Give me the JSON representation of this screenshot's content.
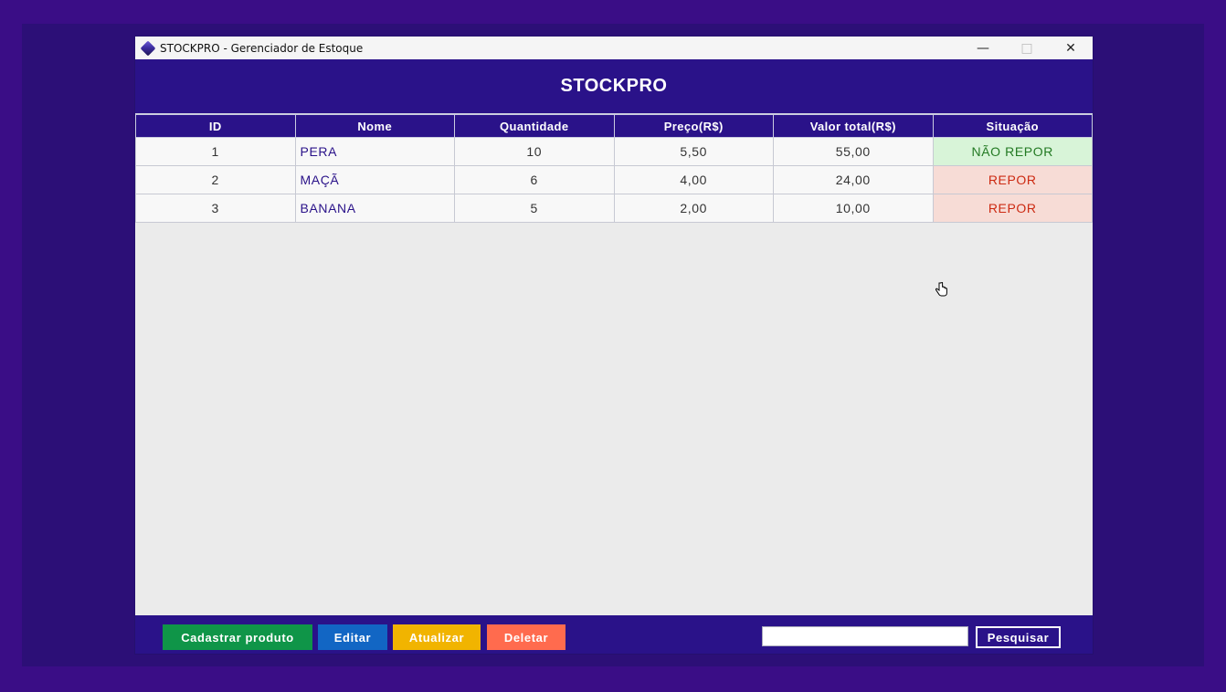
{
  "window": {
    "title": "STOCKPRO - Gerenciador de Estoque",
    "controls": {
      "minimize": "—",
      "maximize": "□",
      "close": "✕"
    }
  },
  "header": {
    "title": "STOCKPRO"
  },
  "table": {
    "columns": [
      "ID",
      "Nome",
      "Quantidade",
      "Preço(R$)",
      "Valor total(R$)",
      "Situação"
    ],
    "rows": [
      {
        "id": "1",
        "nome": "PERA",
        "quantidade": "10",
        "preco": "5,50",
        "valor_total": "55,00",
        "situacao": "NÃO REPOR"
      },
      {
        "id": "2",
        "nome": "MAÇÃ",
        "quantidade": "6",
        "preco": "4,00",
        "valor_total": "24,00",
        "situacao": "REPOR"
      },
      {
        "id": "3",
        "nome": "BANANA",
        "quantidade": "5",
        "preco": "2,00",
        "valor_total": "10,00",
        "situacao": "REPOR"
      }
    ]
  },
  "toolbar": {
    "cadastrar_label": "Cadastrar produto",
    "editar_label": "Editar",
    "atualizar_label": "Atualizar",
    "deletar_label": "Deletar",
    "search_value": "",
    "pesquisar_label": "Pesquisar"
  },
  "colors": {
    "primary": "#2a1289",
    "cadastrar": "#0f9548",
    "editar": "#1266c4",
    "atualizar": "#f1b400",
    "deletar": "#ff6b4e",
    "status_ok_bg": "#d8f4d8",
    "status_repor_bg": "#f7dcd6"
  },
  "icons": {
    "app": "stockpro-cube-icon",
    "cursor": "hand-pointer-icon"
  }
}
